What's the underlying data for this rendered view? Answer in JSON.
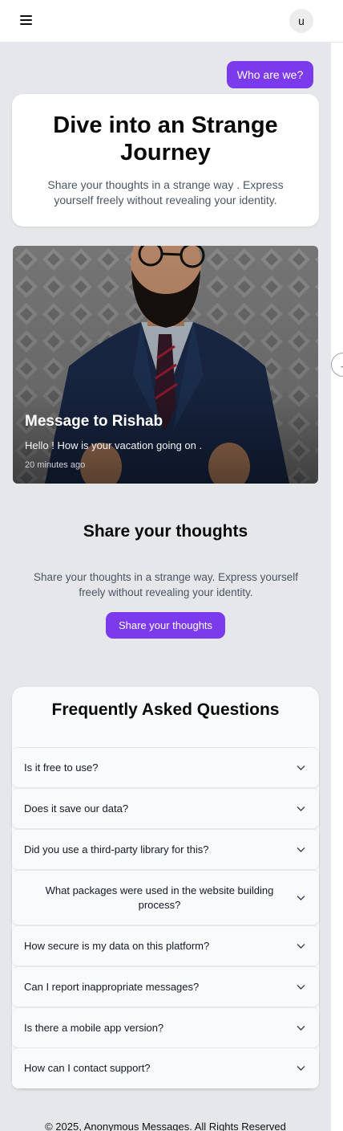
{
  "header": {
    "avatar_initial": "u"
  },
  "hero": {
    "who_button": "Who are we?",
    "title": "Dive into an Strange Journey",
    "subtitle": "Share your thoughts in a strange way . Express yourself freely without revealing your identity."
  },
  "carousel": {
    "message_title": "Message to Rishab",
    "message_body": "Hello ! How is your vacation going on .",
    "message_time": "20 minutes ago",
    "next_glyph": "→"
  },
  "share": {
    "title": "Share your thoughts",
    "subtitle": "Share your thoughts in a strange way. Express yourself freely without revealing your identity.",
    "button": "Share your thoughts"
  },
  "faq": {
    "title": "Frequently Asked Questions",
    "items": [
      {
        "question": "Is it free to use?"
      },
      {
        "question": "Does it save our data?"
      },
      {
        "question": "Did you use a third-party library for this?"
      },
      {
        "question": "What packages were used in the website building process?"
      },
      {
        "question": "How secure is my data on this platform?"
      },
      {
        "question": "Can I report inappropriate messages?"
      },
      {
        "question": "Is there a mobile app version?"
      },
      {
        "question": "How can I contact support?"
      }
    ]
  },
  "footer": {
    "text": "© 2025, Anonymous Messages. All Rights Reserved"
  },
  "colors": {
    "accent": "#7c3aed",
    "page_background": "#e5e7eb"
  }
}
